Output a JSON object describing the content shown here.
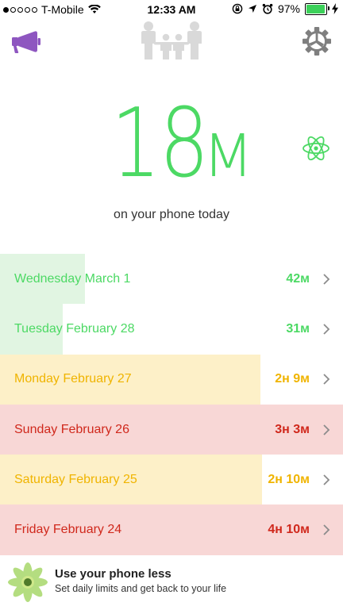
{
  "status_bar": {
    "carrier": "T-Mobile",
    "time": "12:33 AM",
    "battery_text": "97%",
    "battery_level": 0.97,
    "signal_bars_filled": 1,
    "signal_bars_total": 5
  },
  "nav": {
    "left_icon": "megaphone-icon",
    "center_icon": "family-icon",
    "right_icon": "gear-icon"
  },
  "hero": {
    "value": "18",
    "unit": "M",
    "caption": "on your phone today",
    "side_icon": "atom-icon",
    "color": "#4cd964"
  },
  "colors": {
    "green_bar": "#e1f5e2",
    "green_text": "#4cd964",
    "yellow_bar": "#fdf0c8",
    "yellow_text": "#f0b400",
    "red_bar": "#f8d7d6",
    "red_text": "#d0281c"
  },
  "days": [
    {
      "label": "Wednesday March 1",
      "value": "42м",
      "tone": "green",
      "fill": 0.247
    },
    {
      "label": "Tuesday February 28",
      "value": "31м",
      "tone": "green",
      "fill": 0.183
    },
    {
      "label": "Monday February 27",
      "value": "2н 9м",
      "tone": "yellow",
      "fill": 0.759
    },
    {
      "label": "Sunday February 26",
      "value": "3н 3м",
      "tone": "red",
      "fill": 1.0
    },
    {
      "label": "Saturday February 25",
      "value": "2н 10м",
      "tone": "yellow",
      "fill": 0.764
    },
    {
      "label": "Friday February 24",
      "value": "4н 10м",
      "tone": "red",
      "fill": 1.0
    }
  ],
  "promo": {
    "title": "Use your phone less",
    "subtitle": "Set daily limits and get back to your life",
    "icon": "lotus-icon"
  }
}
